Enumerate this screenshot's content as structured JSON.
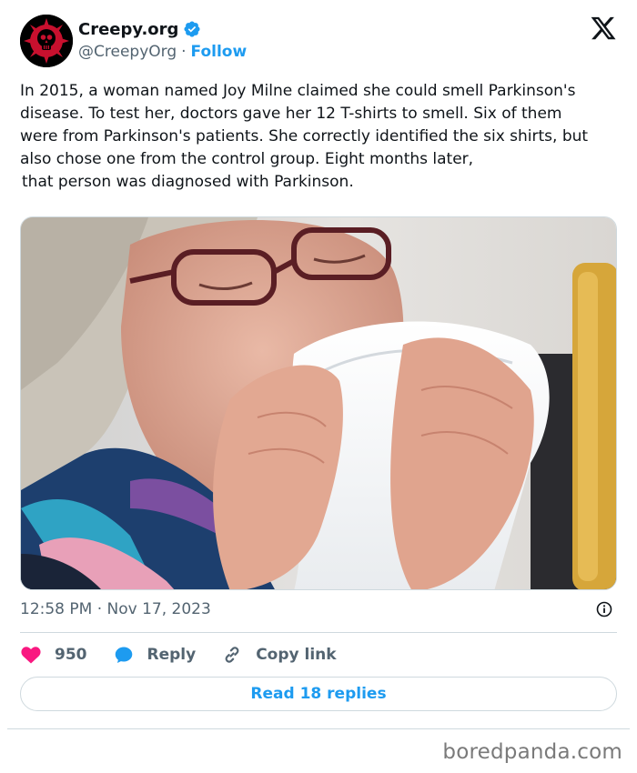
{
  "author": {
    "display_name": "Creepy.org",
    "handle": "@CreepyOrg",
    "separator": "·",
    "follow_label": "Follow"
  },
  "tweet": {
    "lines": [
      "In 2015, a woman named Joy Milne claimed she could smell Parkinson's",
      "disease. To test her, doctors gave her 12 T-shirts to smell. Six of them",
      "were from Parkinson's patients. She correctly identified the six shirts, but",
      "also chose one from the control group. Eight months later,",
      "that person was diagnosed with Parkinson."
    ],
    "timestamp": "12:58 PM · Nov 17, 2023"
  },
  "actions": {
    "like_count": "950",
    "reply_label": "Reply",
    "copy_link_label": "Copy link",
    "read_replies_label": "Read 18 replies"
  },
  "icons": {
    "avatar": "skull-logo-icon",
    "verified": "verified-badge-icon",
    "platform": "x-logo-icon",
    "info": "info-icon",
    "like": "heart-icon",
    "reply": "reply-bubble-icon",
    "copy": "link-icon"
  },
  "colors": {
    "accent": "#1d9bf0",
    "like": "#f91880",
    "muted": "#536471",
    "avatar_red": "#c8102e"
  },
  "watermark": "boredpanda.com"
}
